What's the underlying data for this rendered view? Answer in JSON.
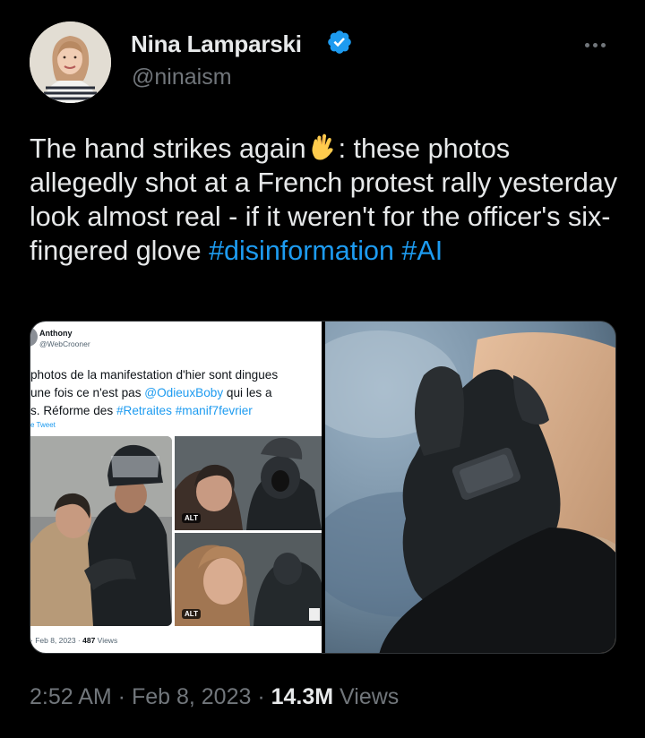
{
  "author": {
    "name": "Nina Lamparski",
    "handle": "@ninaism",
    "verified": true
  },
  "icons": {
    "verified": "verified-badge-icon",
    "more": "more-horizontal-icon",
    "emoji": "vulcan-salute-emoji"
  },
  "tweet": {
    "text_part1": "The hand strikes again",
    "text_part2": ": these photos allegedly shot at a French protest rally yesterday look almost real - if it weren't for the officer's six-fingered glove ",
    "hashtag1": "#disinformation",
    "hashtag2": "#AI"
  },
  "embedded": {
    "name": "Anthony",
    "handle": "@WebCrooner",
    "line1": "photos de la manifestation d'hier sont dingues",
    "line2_pre": "une fois ce n'est pas ",
    "line2_link": "@OdieuxBoby",
    "line2_post": " qui les a",
    "line3_pre": "s. Réforme des ",
    "line3_link1": "#Retraites",
    "line3_link2": "#manif7fevrier",
    "translate": "e Tweet",
    "alt1": "ALT",
    "alt2": "ALT",
    "meta_date": "· Feb 8, 2023 · ",
    "meta_views_count": "487",
    "meta_views_label": " Views"
  },
  "footer": {
    "time": "2:52 AM",
    "sep1": " · ",
    "date": "Feb 8, 2023",
    "sep2": " · ",
    "views_count": "14.3M",
    "views_label": " Views"
  },
  "colors": {
    "background": "#000000",
    "text": "#e7e9ea",
    "muted": "#71767b",
    "link": "#1d9bf0",
    "verified": "#1d9bf0"
  }
}
